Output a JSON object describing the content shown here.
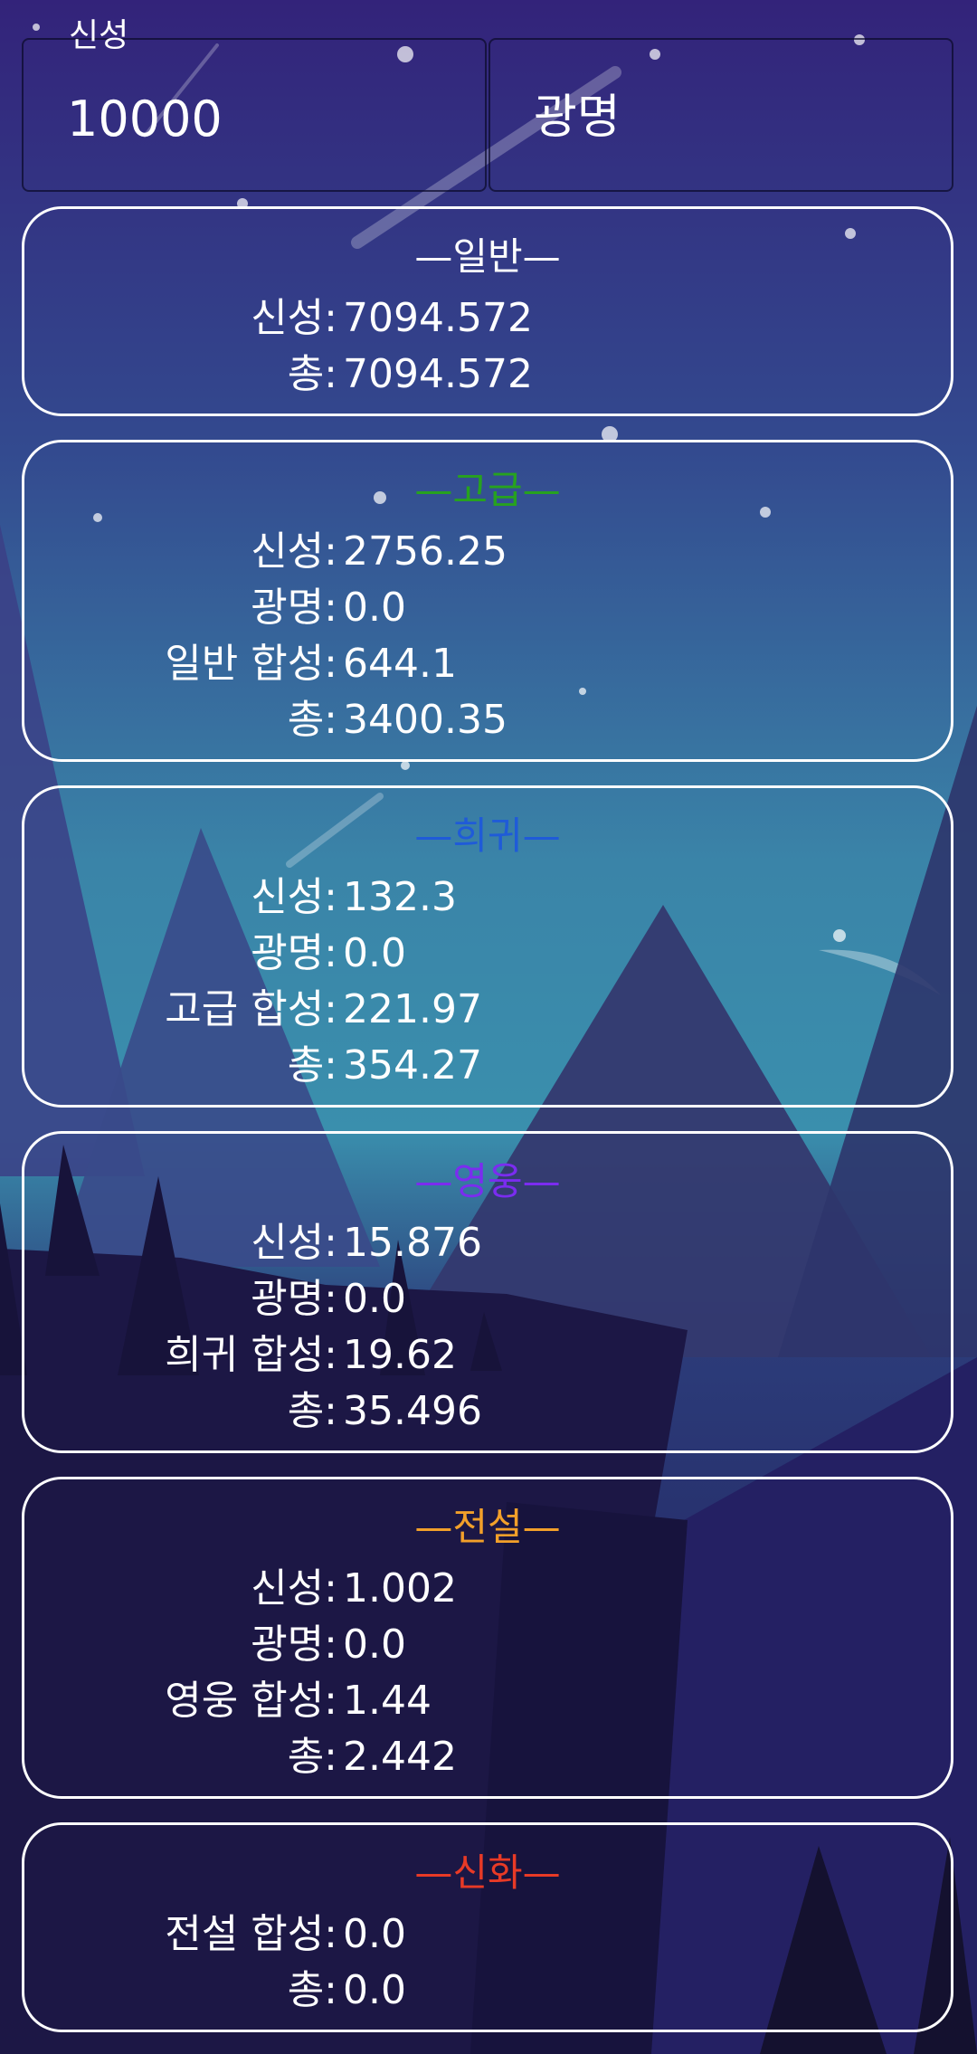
{
  "input_field": {
    "label": "신성",
    "value": "10000"
  },
  "mode_field": {
    "text": "광명"
  },
  "colors": {
    "normal": "#ffffff",
    "advanced": "#27a21f",
    "rare": "#1f5bd8",
    "heroic": "#7b2cf0",
    "legendary": "#f2a02a",
    "mythic": "#e83a26"
  },
  "cards": {
    "normal": {
      "title": "—일반—",
      "rows": [
        {
          "label": "신성:",
          "value": "7094.572"
        },
        {
          "label": "총:",
          "value": "7094.572"
        }
      ]
    },
    "advanced": {
      "title": "—고급—",
      "rows": [
        {
          "label": "신성:",
          "value": "2756.25"
        },
        {
          "label": "광명:",
          "value": "0.0"
        },
        {
          "label": "일반 합성:",
          "value": "644.1"
        },
        {
          "label": "총:",
          "value": "3400.35"
        }
      ]
    },
    "rare": {
      "title": "—희귀—",
      "rows": [
        {
          "label": "신성:",
          "value": "132.3"
        },
        {
          "label": "광명:",
          "value": "0.0"
        },
        {
          "label": "고급 합성:",
          "value": "221.97"
        },
        {
          "label": "총:",
          "value": "354.27"
        }
      ]
    },
    "heroic": {
      "title": "—영웅—",
      "rows": [
        {
          "label": "신성:",
          "value": "15.876"
        },
        {
          "label": "광명:",
          "value": "0.0"
        },
        {
          "label": "희귀 합성:",
          "value": "19.62"
        },
        {
          "label": "총:",
          "value": "35.496"
        }
      ]
    },
    "legendary": {
      "title": "—전설—",
      "rows": [
        {
          "label": "신성:",
          "value": "1.002"
        },
        {
          "label": "광명:",
          "value": "0.0"
        },
        {
          "label": "영웅 합성:",
          "value": "1.44"
        },
        {
          "label": "총:",
          "value": "2.442"
        }
      ]
    },
    "mythic": {
      "title": "—신화—",
      "rows": [
        {
          "label": "전설 합성:",
          "value": "0.0"
        },
        {
          "label": "총:",
          "value": "0.0"
        }
      ]
    }
  }
}
